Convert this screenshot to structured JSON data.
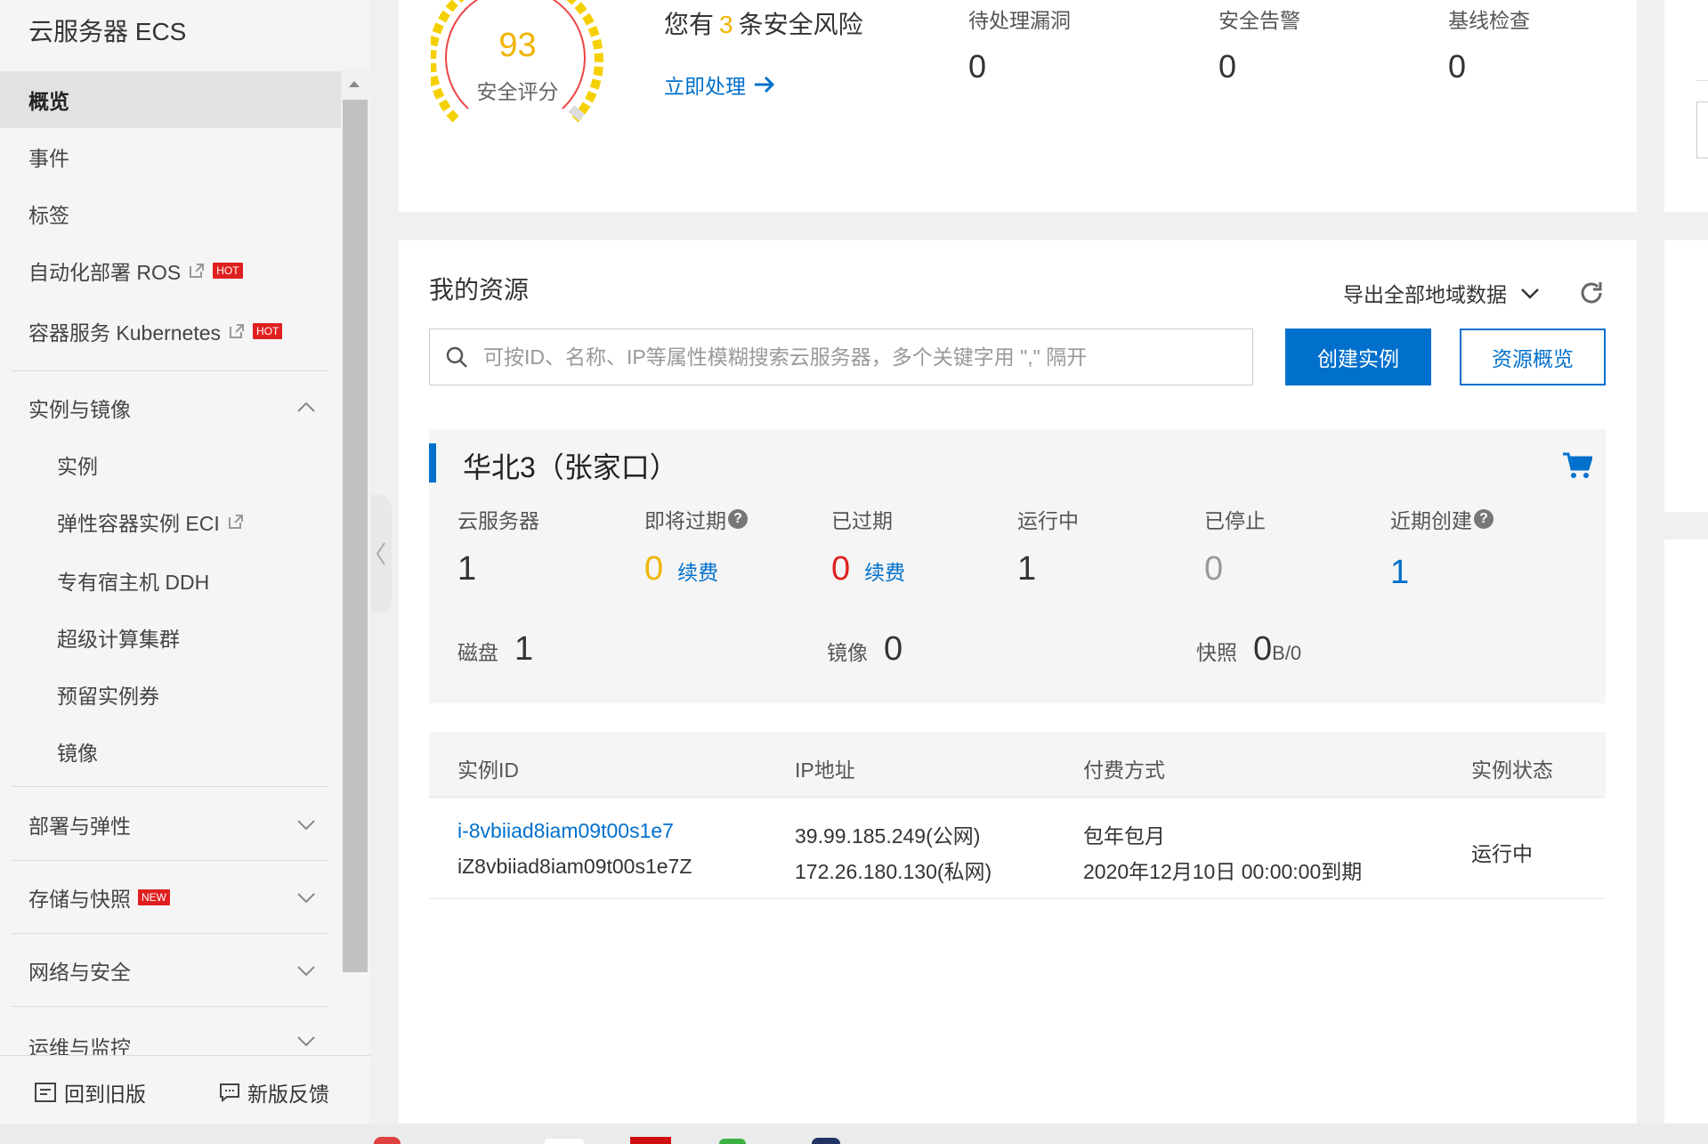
{
  "sidebar": {
    "title": "云服务器 ECS",
    "items": [
      {
        "label": "概览"
      },
      {
        "label": "事件"
      },
      {
        "label": "标签"
      },
      {
        "label": "自动化部署 ROS",
        "badge": "HOT"
      },
      {
        "label": "容器服务 Kubernetes",
        "badge": "HOT"
      }
    ],
    "group_instances": {
      "label": "实例与镜像",
      "children": [
        {
          "label": "实例"
        },
        {
          "label": "弹性容器实例 ECI"
        },
        {
          "label": "专有宿主机 DDH"
        },
        {
          "label": "超级计算集群"
        },
        {
          "label": "预留实例券"
        },
        {
          "label": "镜像"
        }
      ]
    },
    "group_deploy": {
      "label": "部署与弹性"
    },
    "group_storage": {
      "label": "存储与快照",
      "badge": "NEW"
    },
    "group_network": {
      "label": "网络与安全"
    },
    "group_ops": {
      "label": "运维与监控"
    },
    "bottom": {
      "old_version": "回到旧版",
      "feedback": "新版反馈"
    }
  },
  "security": {
    "score": "93",
    "score_label": "安全评分",
    "risk_prefix": "您有",
    "risk_count": "3",
    "risk_suffix": "条安全风险",
    "handle_now": "立即处理",
    "stats": [
      {
        "title": "待处理漏洞",
        "value": "0"
      },
      {
        "title": "安全告警",
        "value": "0"
      },
      {
        "title": "基线检查",
        "value": "0"
      }
    ]
  },
  "resources": {
    "title": "我的资源",
    "export_label": "导出全部地域数据",
    "search_placeholder": "可按ID、名称、IP等属性模糊搜索云服务器，多个关键字用 \",\" 隔开",
    "create_button": "创建实例",
    "overview_button": "资源概览",
    "region": {
      "name": "华北3（张家口）",
      "stats": [
        {
          "label": "云服务器",
          "value": "1"
        },
        {
          "label": "即将过期",
          "value": "0",
          "link": "续费"
        },
        {
          "label": "已过期",
          "value": "0",
          "link": "续费"
        },
        {
          "label": "运行中",
          "value": "1"
        },
        {
          "label": "已停止",
          "value": "0"
        },
        {
          "label": "近期创建",
          "value": "1"
        }
      ],
      "disk_label": "磁盘",
      "disk_value": "1",
      "image_label": "镜像",
      "image_value": "0",
      "snapshot_label": "快照",
      "snapshot_value": "0",
      "snapshot_sub": "B/0"
    },
    "table": {
      "headers": [
        "实例ID",
        "IP地址",
        "付费方式",
        "实例状态"
      ],
      "row": {
        "id_link": "i-8vbiiad8iam09t00s1e7",
        "id_name": "iZ8vbiiad8iam09t00s1e7Z",
        "ip_public": "39.99.185.249(公网)",
        "ip_private": "172.26.180.130(私网)",
        "pay_type": "包年包月",
        "expire": "2020年12月10日 00:00:00到期",
        "status": "运行中"
      }
    }
  },
  "colors": {
    "accent": "#0070cc",
    "warning": "#f0b400",
    "danger": "#e02020"
  }
}
